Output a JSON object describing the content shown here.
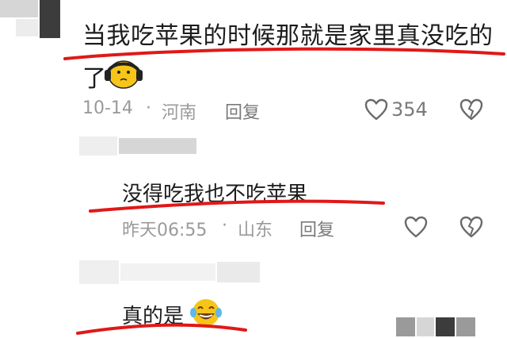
{
  "comments": [
    {
      "text_line1": "当我吃苹果的时候那就是家里真没吃的",
      "text_line2": "了",
      "emoji": "headphones-face-emoji",
      "date": "10-14",
      "location": "河南",
      "reply_label": "回复",
      "like_count": "354"
    },
    {
      "text": "没得吃我也不吃苹果",
      "date": "昨天06:55",
      "location": "山东",
      "reply_label": "回复"
    },
    {
      "text": "真的是",
      "emoji": "laughing-tears-emoji"
    }
  ],
  "separator": "·",
  "colors": {
    "text": "#1c1c1c",
    "meta": "#9a9a9a",
    "underline": "#e01818",
    "emoji_yellow": "#f6c518"
  },
  "icons": [
    "heart-icon",
    "broken-heart-icon"
  ]
}
